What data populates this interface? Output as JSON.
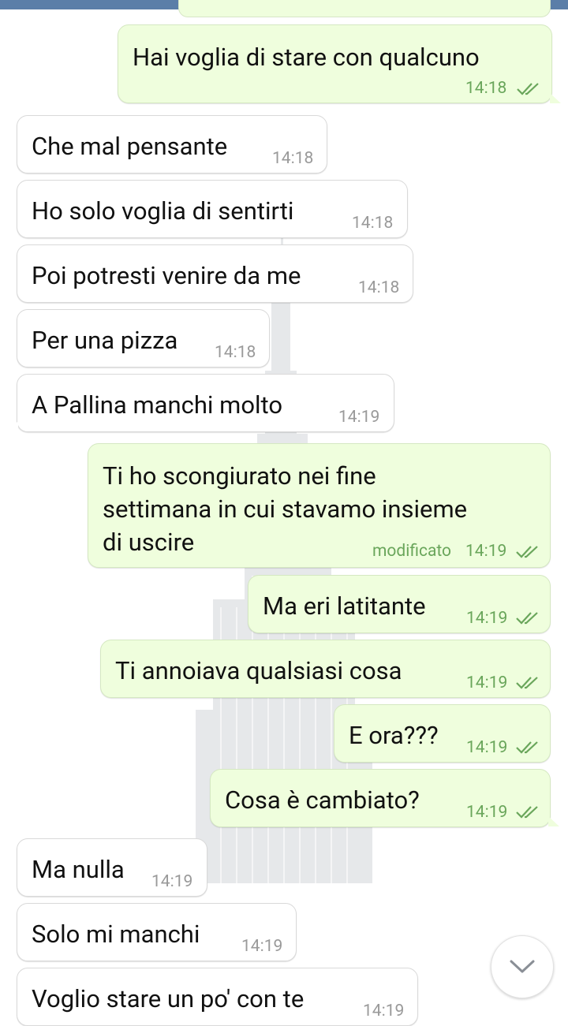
{
  "messages": [
    {
      "text": "Hai voglia di stare con qualcuno",
      "time": "14:18"
    },
    {
      "text": "Che mal pensante",
      "time": "14:18"
    },
    {
      "text": "Ho solo voglia di sentirti",
      "time": "14:18"
    },
    {
      "text": "Poi potresti venire da me",
      "time": "14:18"
    },
    {
      "text": "Per una pizza",
      "time": "14:18"
    },
    {
      "text": "A Pallina manchi molto",
      "time": "14:19"
    },
    {
      "line1": "Ti ho scongiurato nei fine",
      "line2": "settimana in cui stavamo insieme",
      "line3": "di uscire",
      "edited_label": "modificato",
      "time": "14:19"
    },
    {
      "text": "Ma eri latitante",
      "time": "14:19"
    },
    {
      "text": "Ti annoiava qualsiasi cosa",
      "time": "14:19"
    },
    {
      "text": "E ora???",
      "time": "14:19"
    },
    {
      "text": "Cosa è cambiato?",
      "time": "14:19"
    },
    {
      "text": "Ma nulla",
      "time": "14:19"
    },
    {
      "text": "Solo mi manchi",
      "time": "14:19"
    },
    {
      "text": "Voglio stare un po' con te",
      "time": "14:19"
    }
  ],
  "colors": {
    "outgoing_bubble": "#effedd",
    "incoming_bubble": "#ffffff",
    "read_ticks": "#6aa65b",
    "top_bar": "#5b7ea8"
  },
  "icons": {
    "read_status": "double-check-icon",
    "scroll_down": "chevron-down-icon"
  }
}
